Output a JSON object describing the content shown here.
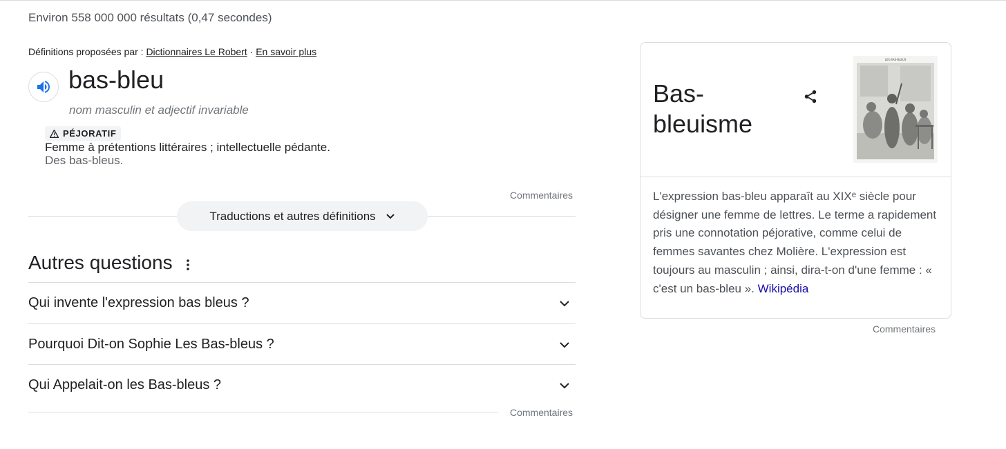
{
  "search": {
    "result_stats": "Environ 558 000 000 résultats (0,47 secondes)"
  },
  "dictionary": {
    "source_prefix": "Définitions proposées par :",
    "source_link": "Dictionnaires Le Robert",
    "separator": "·",
    "learn_more": "En savoir plus",
    "word": "bas-bleu",
    "part_of_speech": "nom masculin et adjectif invariable",
    "register_badge": "PÉJORATIF",
    "definition": "Femme à prétentions littéraires ; intellectuelle pédante.",
    "example": "Des bas-bleus.",
    "feedback": "Commentaires",
    "more_button": "Traductions et autres définitions"
  },
  "related_questions": {
    "title": "Autres questions",
    "items": [
      {
        "question": "Qui invente l'expression bas bleus ?"
      },
      {
        "question": "Pourquoi Dit-on Sophie Les Bas-bleus ?"
      },
      {
        "question": "Qui Appelait-on les Bas-bleus ?"
      }
    ],
    "feedback": "Commentaires"
  },
  "knowledge_panel": {
    "title_line1": "Bas-",
    "title_line2": "bleuisme",
    "image_caption": "LES BAS-BLEUS",
    "description": "L'expression bas-bleu apparaît au XIXᵉ siècle pour désigner une femme de lettres. Le terme a rapidement pris une connotation péjorative, comme celui de femmes savantes chez Molière. L'expression est toujours au masculin ; ainsi, dira-t-on d'une femme : « c'est un bas-bleu ». ",
    "source_link": "Wikipédia",
    "feedback": "Commentaires"
  },
  "icons": {
    "speaker": "speaker-icon",
    "warning": "warning-icon",
    "chevron": "chevron-down-icon",
    "more": "more-vert-icon",
    "share": "share-icon"
  },
  "colors": {
    "link_blue": "#1a0dab",
    "speaker_blue": "#1a73e8",
    "muted_text": "#70757a",
    "border": "#dadce0",
    "pill_bg": "#f1f3f4"
  }
}
